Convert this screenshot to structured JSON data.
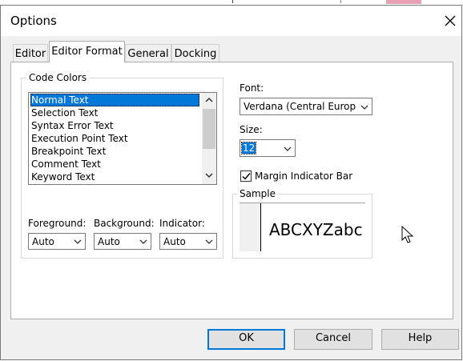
{
  "window": {
    "title": "Options"
  },
  "tabs": [
    {
      "label": "Editor",
      "active": false
    },
    {
      "label": "Editor Format",
      "active": true
    },
    {
      "label": "General",
      "active": false
    },
    {
      "label": "Docking",
      "active": false
    }
  ],
  "code_colors": {
    "legend": "Code Colors",
    "items": [
      "Normal Text",
      "Selection Text",
      "Syntax Error Text",
      "Execution Point Text",
      "Breakpoint Text",
      "Comment Text",
      "Keyword Text"
    ],
    "selected": "Normal Text"
  },
  "color_pickers": {
    "foreground": {
      "label": "Foreground:",
      "value": "Auto"
    },
    "background": {
      "label": "Background:",
      "value": "Auto"
    },
    "indicator": {
      "label": "Indicator:",
      "value": "Auto"
    }
  },
  "font": {
    "label": "Font:",
    "value": "Verdana (Central Europ"
  },
  "size": {
    "label": "Size:",
    "value": "12"
  },
  "margin_indicator": {
    "label": "Margin Indicator Bar",
    "checked": true
  },
  "sample": {
    "legend": "Sample",
    "text": "ABCXYZabc"
  },
  "buttons": {
    "ok": "OK",
    "cancel": "Cancel",
    "help": "Help"
  },
  "colors": {
    "selection": "#0078d7",
    "default_button_border": "#0078d7"
  },
  "icons": {
    "close": "close-icon",
    "scroll_up": "chevron-up-icon",
    "scroll_down": "chevron-down-icon",
    "dropdown": "chevron-down-icon",
    "check": "checkmark-icon",
    "cursor": "mouse-pointer-icon"
  }
}
